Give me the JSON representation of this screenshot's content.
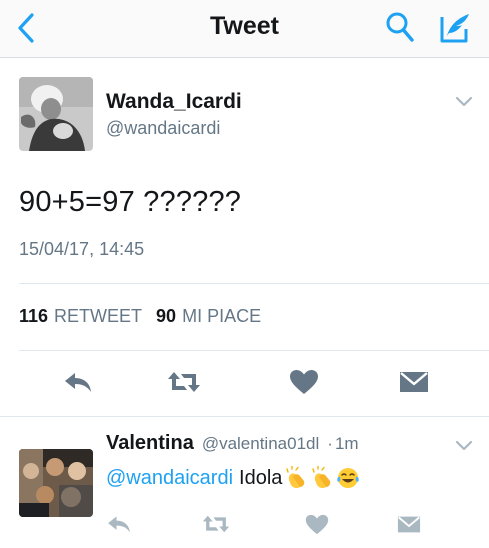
{
  "header": {
    "title": "Tweet",
    "back_icon": "chevron-left-icon",
    "search_icon": "search-icon",
    "compose_icon": "compose-tweet-icon",
    "accent_color": "#1da1f2"
  },
  "tweet": {
    "author_name": "Wanda_Icardi",
    "author_handle": "@wandaicardi",
    "text": "90+5=97 ??????",
    "timestamp": "15/04/17, 14:45",
    "stats": {
      "retweets_count": "116",
      "retweets_label": "RETWEET",
      "likes_count": "90",
      "likes_label": "MI PIACE"
    },
    "actions": [
      "reply-icon",
      "retweet-icon",
      "like-heart-icon",
      "direct-message-icon"
    ]
  },
  "reply": {
    "author_name": "Valentina",
    "author_handle": "@valentina01dl",
    "separator": "·",
    "time": "1m",
    "mention": "@wandaicardi",
    "text": "Idola",
    "emojis": [
      "clapping-hands-emoji",
      "clapping-hands-emoji",
      "tears-of-joy-emoji"
    ],
    "actions": [
      "reply-icon",
      "retweet-icon",
      "like-heart-icon",
      "direct-message-icon"
    ]
  },
  "colors": {
    "text_primary": "#14171a",
    "text_secondary": "#657786",
    "divider": "#e1e8ed",
    "icon_gray": "#657786"
  }
}
